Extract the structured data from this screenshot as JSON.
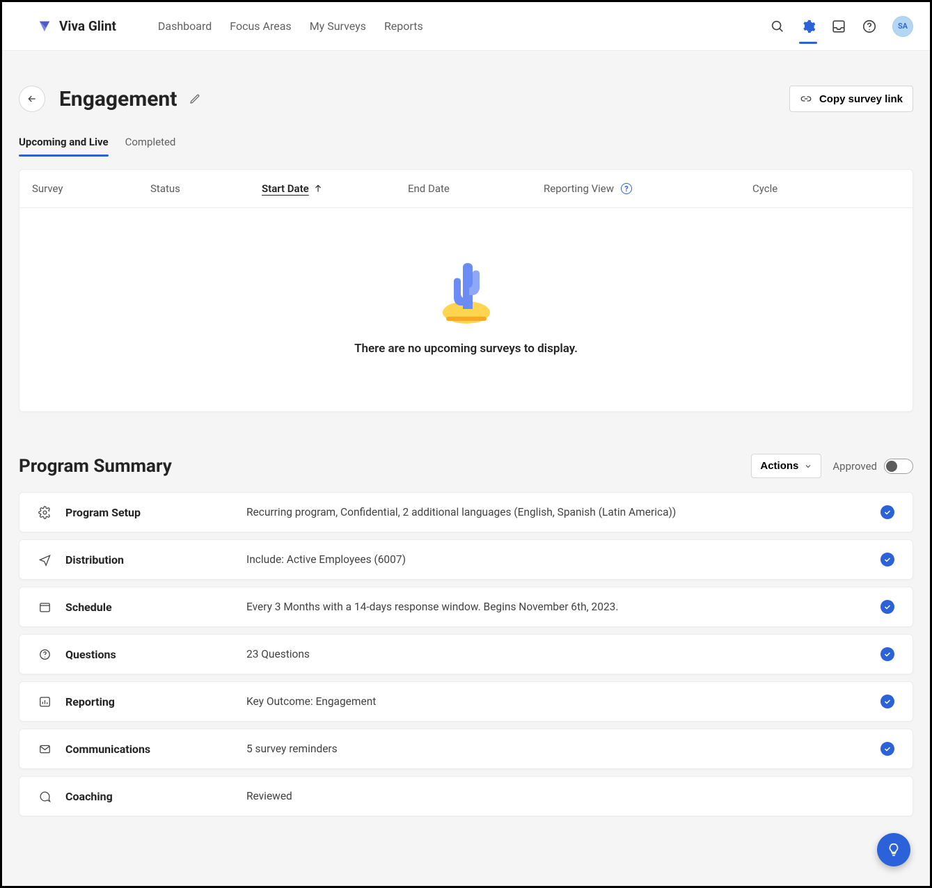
{
  "brand": {
    "name": "Viva Glint"
  },
  "nav": {
    "dashboard": "Dashboard",
    "focus_areas": "Focus Areas",
    "my_surveys": "My Surveys",
    "reports": "Reports"
  },
  "avatar": {
    "initials": "SA"
  },
  "page": {
    "title": "Engagement",
    "copy_link": "Copy survey link"
  },
  "tabs": {
    "upcoming": "Upcoming and Live",
    "completed": "Completed"
  },
  "table": {
    "headers": {
      "survey": "Survey",
      "status": "Status",
      "start_date": "Start Date",
      "end_date": "End Date",
      "reporting_view": "Reporting View",
      "cycle": "Cycle"
    },
    "empty_message": "There are no upcoming surveys to display."
  },
  "program_summary": {
    "title": "Program Summary",
    "actions_label": "Actions",
    "approved_label": "Approved",
    "items": [
      {
        "name": "Program Setup",
        "desc": "Recurring program, Confidential, 2 additional languages (English, Spanish (Latin America))"
      },
      {
        "name": "Distribution",
        "desc": "Include: Active Employees (6007)"
      },
      {
        "name": "Schedule",
        "desc": "Every 3 Months with a 14-days response window. Begins November 6th, 2023."
      },
      {
        "name": "Questions",
        "desc": "23 Questions"
      },
      {
        "name": "Reporting",
        "desc": "Key Outcome: Engagement"
      },
      {
        "name": "Communications",
        "desc": "5 survey reminders"
      },
      {
        "name": "Coaching",
        "desc": "Reviewed"
      }
    ]
  }
}
